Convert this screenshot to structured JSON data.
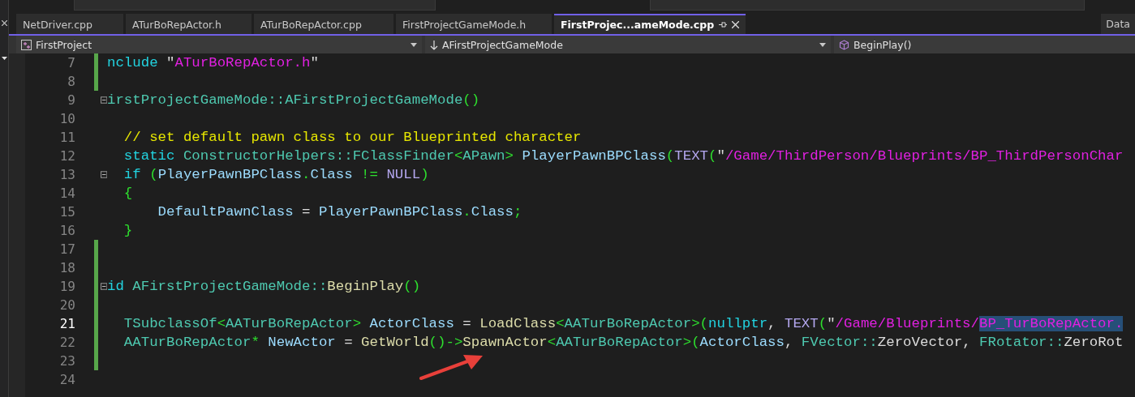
{
  "tabs": [
    {
      "label": "NetDriver.cpp",
      "selected": false
    },
    {
      "label": "ATurBoRepActor.h",
      "selected": false
    },
    {
      "label": "ATurBoRepActor.cpp",
      "selected": false
    },
    {
      "label": "FirstProjectGameMode.h",
      "selected": false
    },
    {
      "label": "FirstProjec...ameMode.cpp",
      "selected": true
    }
  ],
  "side_tab": {
    "label": "Data"
  },
  "nav": [
    {
      "kind": "project",
      "label": "FirstProject"
    },
    {
      "kind": "class",
      "label": "AFirstProjectGameMode"
    },
    {
      "kind": "member",
      "label": "BeginPlay()"
    }
  ],
  "lines": [
    {
      "number": "7",
      "current": false,
      "changed": true,
      "foldable": false,
      "tokens": [
        {
          "kind": "keyword",
          "text": "nclude "
        },
        {
          "kind": "plain",
          "text": "\""
        },
        {
          "kind": "string",
          "text": "ATurBoRepActor.h"
        },
        {
          "kind": "plain",
          "text": "\""
        }
      ]
    },
    {
      "number": "8",
      "current": false,
      "changed": true,
      "foldable": false
    },
    {
      "number": "9",
      "current": false,
      "changed": false,
      "foldable": true,
      "tokens": [
        {
          "kind": "type",
          "text": "irstProjectGameMode::AFirstProjectGameMode"
        },
        {
          "kind": "bracket",
          "text": "()"
        }
      ]
    },
    {
      "number": "10",
      "current": false,
      "changed": false,
      "foldable": false
    },
    {
      "number": "11",
      "current": false,
      "changed": false,
      "foldable": false,
      "tokens": [
        {
          "kind": "comment",
          "text": "  // set default pawn class to our Blueprinted character"
        }
      ]
    },
    {
      "number": "12",
      "current": false,
      "changed": false,
      "foldable": false,
      "tokens": [
        {
          "kind": "keyword",
          "text": "  static "
        },
        {
          "kind": "type",
          "text": "ConstructorHelpers::FClassFinder"
        },
        {
          "kind": "bracket",
          "text": "<"
        },
        {
          "kind": "type",
          "text": "APawn"
        },
        {
          "kind": "bracket",
          "text": "> "
        },
        {
          "kind": "ident",
          "text": "PlayerPawnBPClass"
        },
        {
          "kind": "bracket",
          "text": "("
        },
        {
          "kind": "macro",
          "text": "TEXT"
        },
        {
          "kind": "bracket",
          "text": "("
        },
        {
          "kind": "plain",
          "text": "\""
        },
        {
          "kind": "string",
          "text": "/Game/ThirdPerson/Blueprints/BP_ThirdPersonChar"
        }
      ]
    },
    {
      "number": "13",
      "current": false,
      "changed": false,
      "foldable": true,
      "tokens": [
        {
          "kind": "keyword",
          "text": "  if "
        },
        {
          "kind": "bracket",
          "text": "("
        },
        {
          "kind": "ident",
          "text": "PlayerPawnBPClass"
        },
        {
          "kind": "bracket",
          "text": "."
        },
        {
          "kind": "ident",
          "text": "Class "
        },
        {
          "kind": "bracket",
          "text": "!= "
        },
        {
          "kind": "macro",
          "text": "NULL"
        },
        {
          "kind": "bracket",
          "text": ")"
        }
      ]
    },
    {
      "number": "14",
      "current": false,
      "changed": false,
      "foldable": false,
      "tokens": [
        {
          "kind": "bracket",
          "text": "  {"
        }
      ]
    },
    {
      "number": "15",
      "current": false,
      "changed": false,
      "foldable": false,
      "tokens": [
        {
          "kind": "ident",
          "text": "      DefaultPawnClass"
        },
        {
          "kind": "plain",
          "text": " = "
        },
        {
          "kind": "ident",
          "text": "PlayerPawnBPClass"
        },
        {
          "kind": "bracket",
          "text": "."
        },
        {
          "kind": "ident",
          "text": "Class"
        },
        {
          "kind": "bracket",
          "text": ";"
        }
      ]
    },
    {
      "number": "16",
      "current": false,
      "changed": false,
      "foldable": false,
      "tokens": [
        {
          "kind": "bracket",
          "text": "  }"
        }
      ]
    },
    {
      "number": "17",
      "current": false,
      "changed": true,
      "foldable": false
    },
    {
      "number": "18",
      "current": false,
      "changed": true,
      "foldable": false
    },
    {
      "number": "19",
      "current": false,
      "changed": true,
      "foldable": true,
      "tokens": [
        {
          "kind": "keyword",
          "text": "id "
        },
        {
          "kind": "type",
          "text": "AFirstProjectGameMode::"
        },
        {
          "kind": "function",
          "text": "BeginPlay"
        },
        {
          "kind": "bracket",
          "text": "()"
        }
      ]
    },
    {
      "number": "20",
      "current": false,
      "changed": true,
      "foldable": false
    },
    {
      "number": "21",
      "current": true,
      "changed": true,
      "foldable": false,
      "tokens": [
        {
          "kind": "type",
          "text": "  TSubclassOf"
        },
        {
          "kind": "bracket",
          "text": "<"
        },
        {
          "kind": "type",
          "text": "AATurBoRepActor"
        },
        {
          "kind": "bracket",
          "text": "> "
        },
        {
          "kind": "ident",
          "text": "ActorClass"
        },
        {
          "kind": "plain",
          "text": " = "
        },
        {
          "kind": "function",
          "text": "LoadClass"
        },
        {
          "kind": "bracket",
          "text": "<"
        },
        {
          "kind": "type",
          "text": "AATurBoRepActor"
        },
        {
          "kind": "bracket",
          "text": ">("
        },
        {
          "kind": "keyword",
          "text": "nullptr"
        },
        {
          "kind": "plain",
          "text": ", "
        },
        {
          "kind": "macro",
          "text": "TEXT"
        },
        {
          "kind": "bracket",
          "text": "("
        },
        {
          "kind": "plain",
          "text": "\""
        },
        {
          "kind": "string",
          "text": "/Game/Blueprints/"
        },
        {
          "kind": "selected-string",
          "text": "BP_TurBoRepActor."
        }
      ]
    },
    {
      "number": "22",
      "current": false,
      "changed": true,
      "foldable": false,
      "tokens": [
        {
          "kind": "type",
          "text": "  AATurBoRepActor"
        },
        {
          "kind": "bracket",
          "text": "* "
        },
        {
          "kind": "ident",
          "text": "NewActor"
        },
        {
          "kind": "plain",
          "text": " = "
        },
        {
          "kind": "function",
          "text": "GetWorld"
        },
        {
          "kind": "bracket",
          "text": "()->"
        },
        {
          "kind": "function",
          "text": "SpawnActor"
        },
        {
          "kind": "bracket",
          "text": "<"
        },
        {
          "kind": "type",
          "text": "AATurBoRepActor"
        },
        {
          "kind": "bracket",
          "text": ">("
        },
        {
          "kind": "ident",
          "text": "ActorClass"
        },
        {
          "kind": "plain",
          "text": ", "
        },
        {
          "kind": "type",
          "text": "FVector::"
        },
        {
          "kind": "plain",
          "text": "ZeroVector, "
        },
        {
          "kind": "type",
          "text": "FRotator::"
        },
        {
          "kind": "plain",
          "text": "ZeroRot"
        }
      ]
    },
    {
      "number": "23",
      "current": false,
      "changed": true,
      "foldable": false
    },
    {
      "number": "24",
      "current": false,
      "changed": false,
      "foldable": false
    }
  ]
}
